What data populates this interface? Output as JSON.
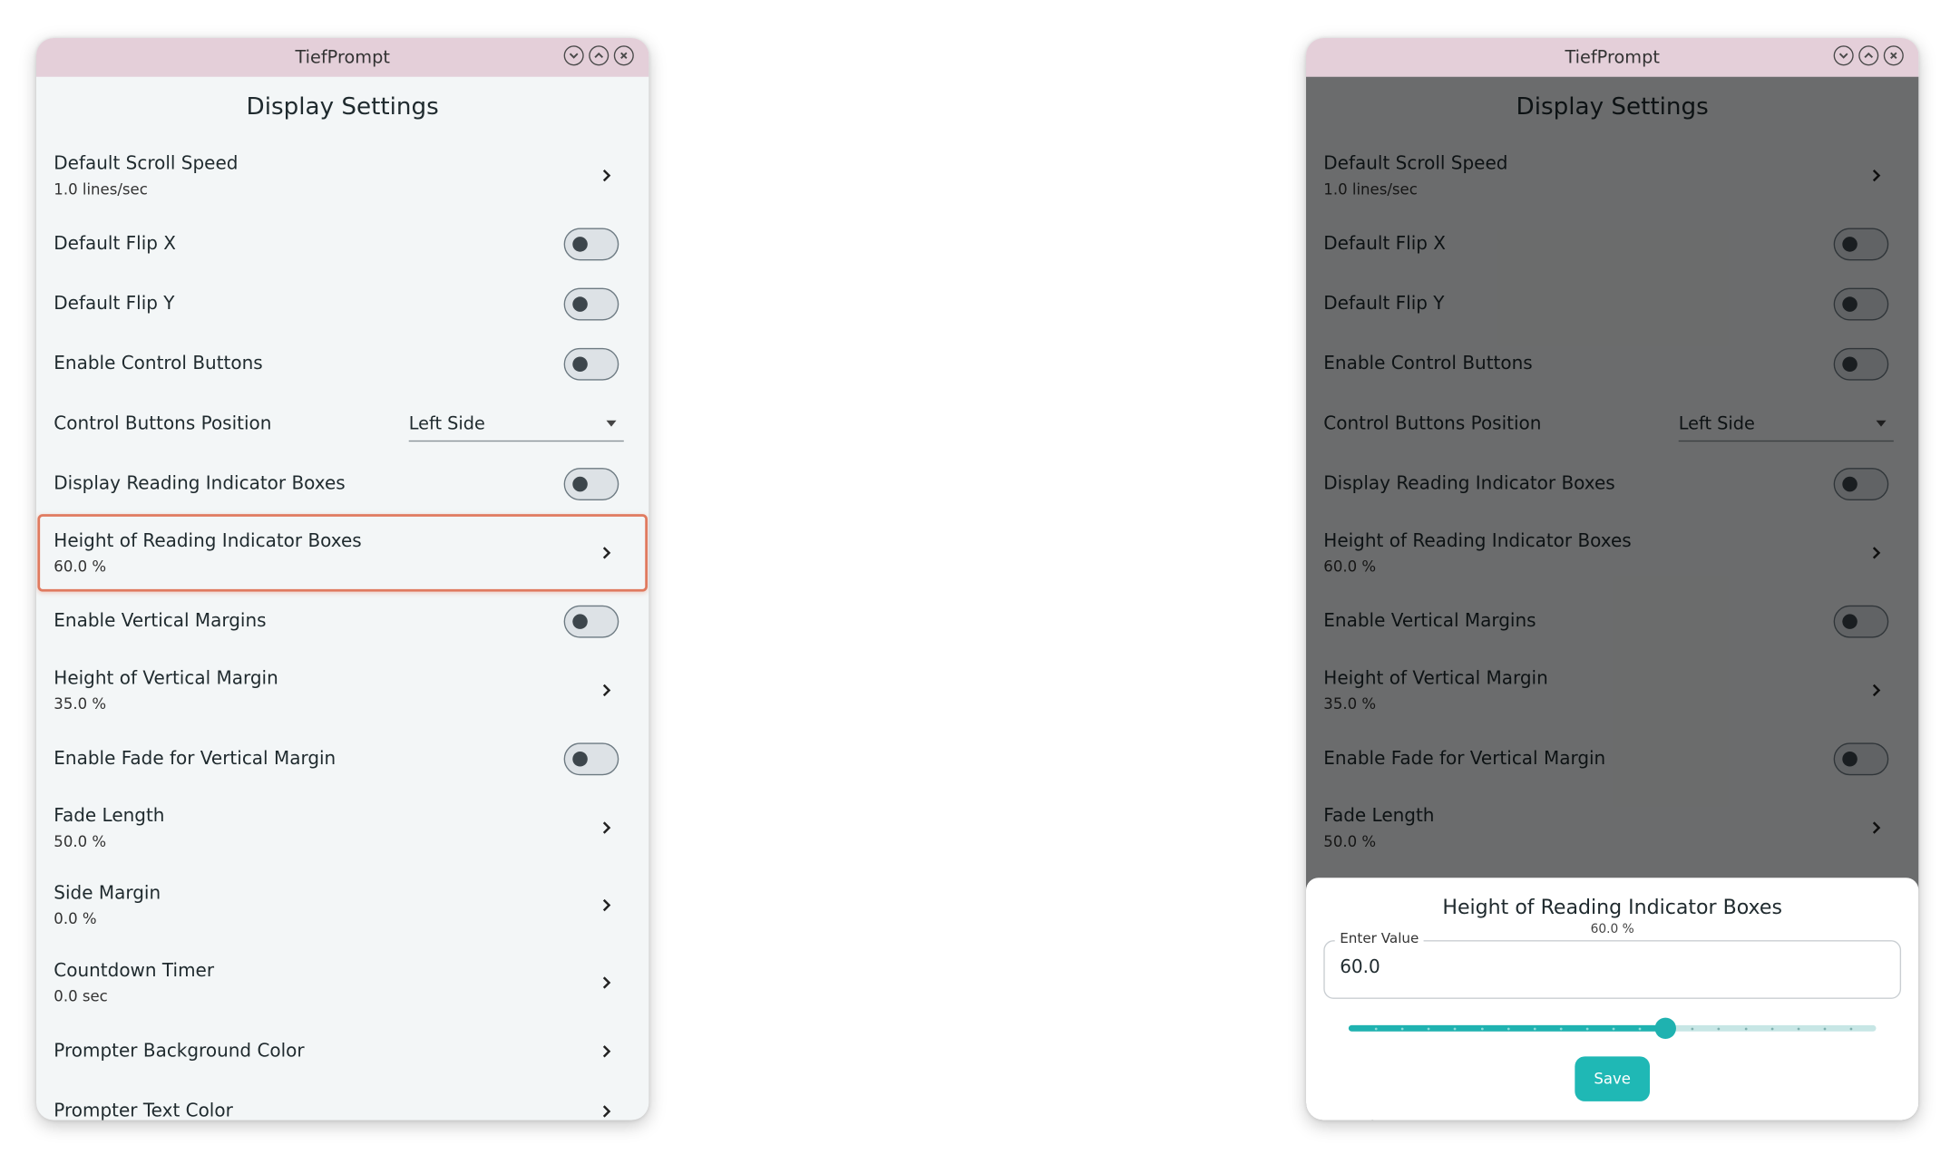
{
  "window": {
    "title": "TiefPrompt",
    "controls": [
      "minimize",
      "maximize",
      "close"
    ]
  },
  "page_title": "Display Settings",
  "settings": [
    {
      "id": "scroll-speed",
      "type": "nav",
      "label": "Default Scroll Speed",
      "value": "1.0 lines/sec"
    },
    {
      "id": "flip-x",
      "type": "toggle",
      "label": "Default Flip X",
      "on": false
    },
    {
      "id": "flip-y",
      "type": "toggle",
      "label": "Default Flip Y",
      "on": false
    },
    {
      "id": "control-buttons",
      "type": "toggle",
      "label": "Enable Control Buttons",
      "on": false
    },
    {
      "id": "control-buttons-position",
      "type": "select",
      "label": "Control Buttons Position",
      "value": "Left Side"
    },
    {
      "id": "reading-indicator-boxes",
      "type": "toggle",
      "label": "Display Reading Indicator Boxes",
      "on": false
    },
    {
      "id": "reading-indicator-height",
      "type": "nav",
      "label": "Height of Reading Indicator Boxes",
      "value": "60.0 %"
    },
    {
      "id": "vertical-margins",
      "type": "toggle",
      "label": "Enable Vertical Margins",
      "on": false
    },
    {
      "id": "vertical-margin-height",
      "type": "nav",
      "label": "Height of Vertical Margin",
      "value": "35.0 %"
    },
    {
      "id": "fade-vertical-margin",
      "type": "toggle",
      "label": "Enable Fade for Vertical Margin",
      "on": false
    },
    {
      "id": "fade-length",
      "type": "nav",
      "label": "Fade Length",
      "value": "50.0 %"
    },
    {
      "id": "side-margin",
      "type": "nav",
      "label": "Side Margin",
      "value": "0.0 %"
    },
    {
      "id": "countdown-timer",
      "type": "nav",
      "label": "Countdown Timer",
      "value": "0.0 sec"
    },
    {
      "id": "bg-color",
      "type": "nav",
      "label": "Prompter Background Color"
    },
    {
      "id": "text-color",
      "type": "nav",
      "label": "Prompter Text Color"
    }
  ],
  "highlighted_setting": "reading-indicator-height",
  "dialog": {
    "title": "Height of Reading Indicator Boxes",
    "subtitle": "60.0 %",
    "field_label": "Enter Value",
    "field_value": "60.0",
    "slider_fraction": 0.6,
    "slider_steps": 20,
    "save_label": "Save"
  },
  "colors": {
    "titlebar": "#e4cfd9",
    "window_bg": "#f3f6f7",
    "accent": "#1fb2b0",
    "highlight": "#e07a5f"
  }
}
